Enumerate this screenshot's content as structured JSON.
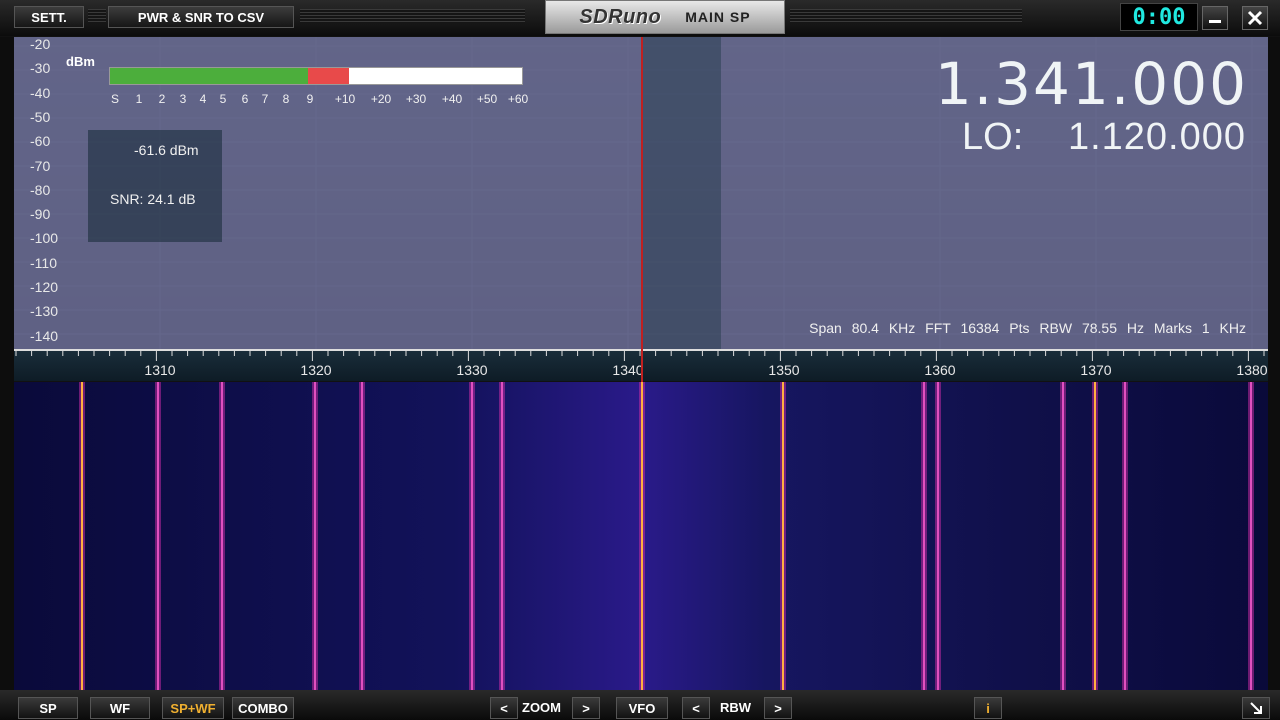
{
  "topbar": {
    "sett_label": "SETT.",
    "pwr_label": "PWR & SNR TO CSV",
    "logo": "SDRuno",
    "title": "MAIN SP",
    "clock": "0:00",
    "minimize_icon": "minimize-icon",
    "close_icon": "close-icon"
  },
  "spectrum": {
    "unit_label": "dBm",
    "y_ticks": [
      "-20",
      "-30",
      "-40",
      "-50",
      "-60",
      "-70",
      "-80",
      "-90",
      "-100",
      "-110",
      "-120",
      "-130",
      "-140"
    ],
    "s_meter_labels": [
      "S",
      "1",
      "2",
      "3",
      "4",
      "5",
      "6",
      "7",
      "8",
      "9",
      "+10",
      "+20",
      "+30",
      "+40",
      "+50",
      "+60"
    ],
    "s_meter_green_fraction": 0.48,
    "s_meter_red_fraction": 0.1,
    "power_readout": "-61.6 dBm",
    "snr_readout": "SNR: 24.1 dB",
    "frequency": "1.341.000",
    "lo_label": "LO:",
    "lo_value": "1.120.000",
    "info": "Span 80.4 KHz   FFT 16384 Pts   RBW 78.55 Hz   Marks 1 KHz",
    "x_ticks": [
      "1310",
      "1320",
      "1330",
      "1340",
      "1350",
      "1360",
      "1370",
      "1380"
    ],
    "colors": {
      "vfo_line": "#c02020",
      "meter_green": "#4cae3c",
      "meter_red": "#e84a4a",
      "clock": "#20e8e0"
    }
  },
  "bottombar": {
    "sp": "SP",
    "wf": "WF",
    "spwf": "SP+WF",
    "combo": "COMBO",
    "zoom": "ZOOM",
    "vfo": "VFO",
    "rbw": "RBW",
    "prev_icon": "chevron-left-icon",
    "next_icon": "chevron-right-icon",
    "info_label": "i",
    "resize_icon": "resize-icon"
  }
}
